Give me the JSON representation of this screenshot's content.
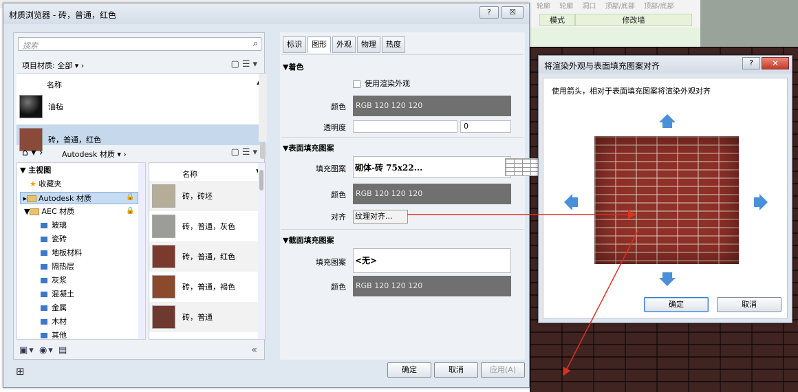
{
  "bg_ribbon": {
    "top_items": [
      "轮廓",
      "轮廓",
      "洞口",
      "顶部/底部",
      "顶部/底部"
    ],
    "tabs": [
      "模式",
      "修改墙"
    ]
  },
  "material_browser": {
    "title": "材质浏览器 - 砖，普通，红色",
    "help_btn": "?",
    "close_btn": "☒",
    "search_placeholder": "搜索",
    "project_filter": "项目材质: 全部",
    "name_header": "名称",
    "project_materials": [
      {
        "name": "油毡",
        "swatch": "#1b1b1b"
      },
      {
        "name": "砖，普通，红色",
        "swatch": "#8a4a3a"
      }
    ],
    "library_breadcrumb": "Autodesk 材质",
    "tree": {
      "root": "主视图",
      "favorites": "收藏夹",
      "autodesk": "Autodesk 材质",
      "aec": "AEC 材质",
      "children": [
        "玻璃",
        "瓷砖",
        "地板材料",
        "隔热层",
        "灰浆",
        "混凝土",
        "金属",
        "木材",
        "其他"
      ]
    },
    "materials_header": "名称",
    "materials": [
      {
        "name": "砖，砖坯",
        "swatch": "#b6ad98"
      },
      {
        "name": "砖，普通，灰色",
        "swatch": "#9c9c98"
      },
      {
        "name": "砖，普通，红色",
        "swatch": "#7b3a2e"
      },
      {
        "name": "砖，普通，褐色",
        "swatch": "#8a4b2c"
      },
      {
        "name": "砖，普通",
        "swatch": "#6e3a30"
      }
    ],
    "tabs": [
      "标识",
      "图形",
      "外观",
      "物理",
      "热度"
    ],
    "active_tab": "图形",
    "shading": {
      "header": "▼着色",
      "use_render_label": "使用渲染外观",
      "color_label": "颜色",
      "color_value": "RGB 120 120 120",
      "transparency_label": "透明度",
      "transparency_value": "0"
    },
    "surface_pattern": {
      "header": "▼表面填充图案",
      "pattern_label": "填充图案",
      "pattern_value": "砌体-砖 75x22...",
      "color_label": "颜色",
      "color_value": "RGB 120 120 120",
      "align_label": "对齐",
      "align_value": "纹理对齐..."
    },
    "cut_pattern": {
      "header": "▼截面填充图案",
      "pattern_label": "填充图案",
      "pattern_value": "<无>",
      "color_label": "颜色",
      "color_value": "RGB 120 120 120"
    },
    "ok": "确定",
    "cancel": "取消",
    "apply": "应用(A)"
  },
  "align_dialog": {
    "title": "将渲染外观与表面填充图案对齐",
    "help_btn": "?",
    "close_btn": "✕",
    "instruction": "使用箭头，相对于表面填充图案将渲染外观对齐",
    "ok": "确定",
    "cancel": "取消"
  },
  "colors": {
    "arrow": "#4a90d8",
    "annotation": "#e03020",
    "brick": "#8e3128",
    "swatch_gray": "#707070"
  }
}
